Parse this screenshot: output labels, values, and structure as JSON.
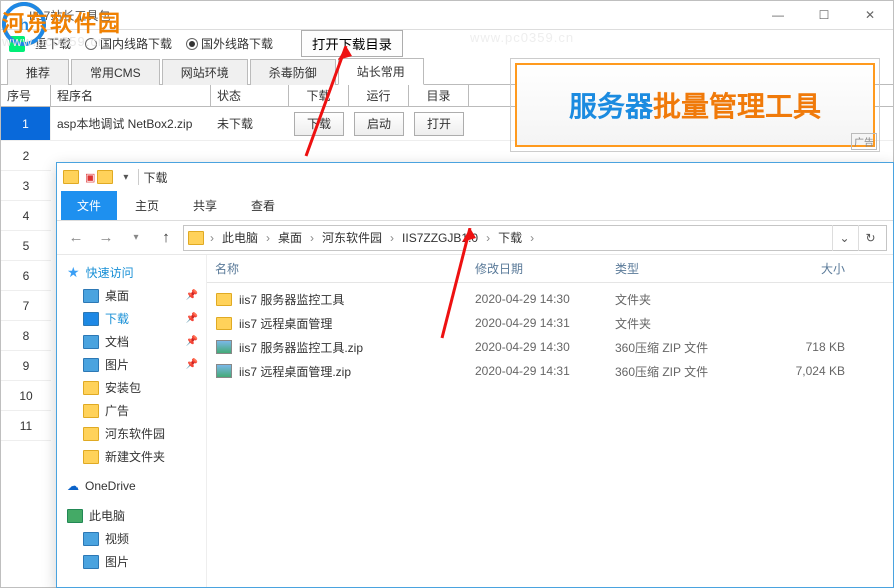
{
  "app": {
    "title": "IIS7站长工具包",
    "toolbar_label": "重下载",
    "radio1": "国内线路下载",
    "radio2": "国外线路下载",
    "open_dir_btn": "打开下载目录"
  },
  "cat_tabs": [
    "推荐",
    "常用CMS",
    "网站环境",
    "杀毒防御",
    "站长常用"
  ],
  "grid": {
    "headers": {
      "seq": "序号",
      "name": "程序名",
      "status": "状态",
      "download": "下载",
      "run": "运行",
      "open": "目录"
    },
    "row": {
      "seq": "1",
      "name": "asp本地调试 NetBox2.zip",
      "status": "未下载",
      "dl_btn": "下载",
      "run_btn": "启动",
      "open_btn": "打开"
    },
    "indices": [
      "2",
      "3",
      "4",
      "5",
      "6",
      "7",
      "8",
      "9",
      "10",
      "11"
    ]
  },
  "banner": {
    "t1": "服务器",
    "t2": "批量管理工具",
    "ad": "广告"
  },
  "explorer": {
    "title": "下载",
    "tabs": {
      "file": "文件",
      "home": "主页",
      "share": "共享",
      "view": "查看"
    },
    "crumbs": [
      "此电脑",
      "桌面",
      "河东软件园",
      "IIS7ZZGJB1.0",
      "下载"
    ],
    "cols": {
      "name": "名称",
      "date": "修改日期",
      "type": "类型",
      "size": "大小"
    },
    "side": {
      "quick": "快速访问",
      "quick_items": [
        "桌面",
        "下载",
        "文档",
        "图片",
        "安装包",
        "广告",
        "河东软件园",
        "新建文件夹"
      ],
      "onedrive": "OneDrive",
      "thispc": "此电脑",
      "pc_items": [
        "视频",
        "图片"
      ]
    },
    "files": [
      {
        "icon": "folder",
        "name": "iis7 服务器监控工具",
        "date": "2020-04-29 14:30",
        "type": "文件夹",
        "size": ""
      },
      {
        "icon": "folder",
        "name": "iis7 远程桌面管理",
        "date": "2020-04-29 14:31",
        "type": "文件夹",
        "size": ""
      },
      {
        "icon": "zip",
        "name": "iis7 服务器监控工具.zip",
        "date": "2020-04-29 14:30",
        "type": "360压缩 ZIP 文件",
        "size": "718 KB"
      },
      {
        "icon": "zip",
        "name": "iis7 远程桌面管理.zip",
        "date": "2020-04-29 14:31",
        "type": "360压缩 ZIP 文件",
        "size": "7,024 KB"
      }
    ]
  },
  "watermark": {
    "brand": "河东软件园",
    "url": "www.pc0359.cn"
  }
}
